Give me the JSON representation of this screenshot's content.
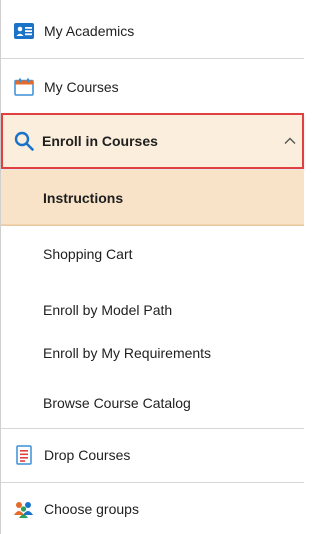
{
  "nav": {
    "my_academics": {
      "label": "My Academics",
      "icon": "academics-card-icon"
    },
    "my_courses": {
      "label": "My Courses",
      "icon": "calendar-icon"
    },
    "enroll": {
      "label": "Enroll in Courses",
      "icon": "search-icon",
      "expanded": true,
      "subitems": [
        {
          "label": "Instructions",
          "active": true
        },
        {
          "label": "Shopping Cart",
          "active": false
        },
        {
          "label": "Enroll by Model Path",
          "active": false
        },
        {
          "label": "Enroll by My Requirements",
          "active": false
        },
        {
          "label": "Browse Course Catalog",
          "active": false
        }
      ]
    },
    "drop_courses": {
      "label": "Drop Courses",
      "icon": "drop-document-icon"
    },
    "choose_groups": {
      "label": "Choose groups",
      "icon": "people-group-icon"
    }
  },
  "colors": {
    "highlight_border": "#e04040",
    "highlight_bg": "#fbeedd",
    "active_bg": "#f8e3c8",
    "icon_blue": "#1a73c8"
  }
}
